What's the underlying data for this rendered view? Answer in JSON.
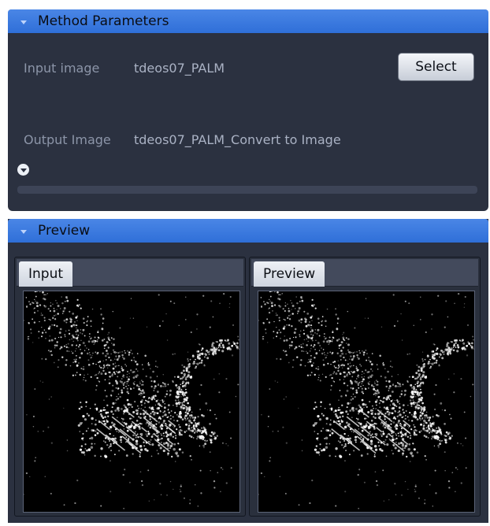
{
  "method_parameters": {
    "header": "Method Parameters",
    "input_label": "Input image",
    "input_value": "tdeos07_PALM",
    "select_label": "Select",
    "output_label": "Output Image",
    "output_value": "tdeos07_PALM_Convert to Image"
  },
  "preview": {
    "header": "Preview",
    "left_tab": "Input",
    "right_tab": "Preview"
  },
  "icons": {
    "collapse": "chevron-down-icon",
    "expand": "expand-circle-icon"
  },
  "colors": {
    "accent": "#2f6fd8",
    "panel": "#2b3140"
  }
}
